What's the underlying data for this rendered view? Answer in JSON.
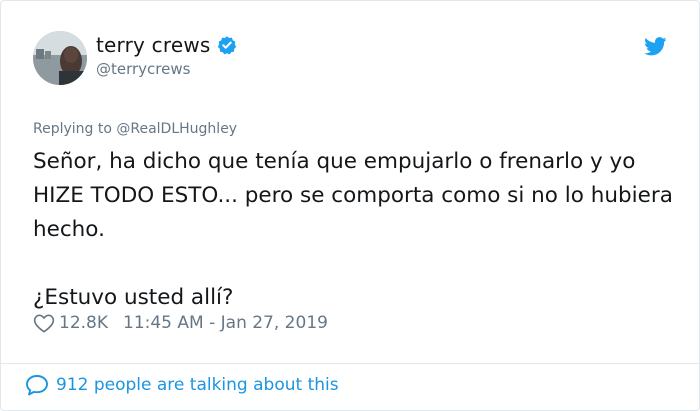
{
  "author": {
    "display_name": "terry crews",
    "handle": "@terrycrews",
    "verified": true
  },
  "reply_context": "Replying to @RealDLHughley",
  "tweet": {
    "line_block_1": "Señor, ha dicho que tenía que empujarlo o frenarlo y yo HIZE TODO ESTO... pero se comporta como si no lo hubiera hecho.",
    "line_block_2": "¿Estuvo usted allí?"
  },
  "meta": {
    "likes": "12.8K",
    "timestamp": "11:45 AM - Jan 27, 2019"
  },
  "footer": {
    "conversation_text": "912 people are talking about this"
  },
  "icons": {
    "verified": "verified-badge-icon",
    "bird": "twitter-bird-icon",
    "heart": "heart-icon",
    "bubble": "comment-bubble-icon"
  },
  "colors": {
    "brand_blue": "#1da1f2",
    "link_blue": "#1b95e0",
    "muted": "#657786",
    "text": "#14171a"
  }
}
